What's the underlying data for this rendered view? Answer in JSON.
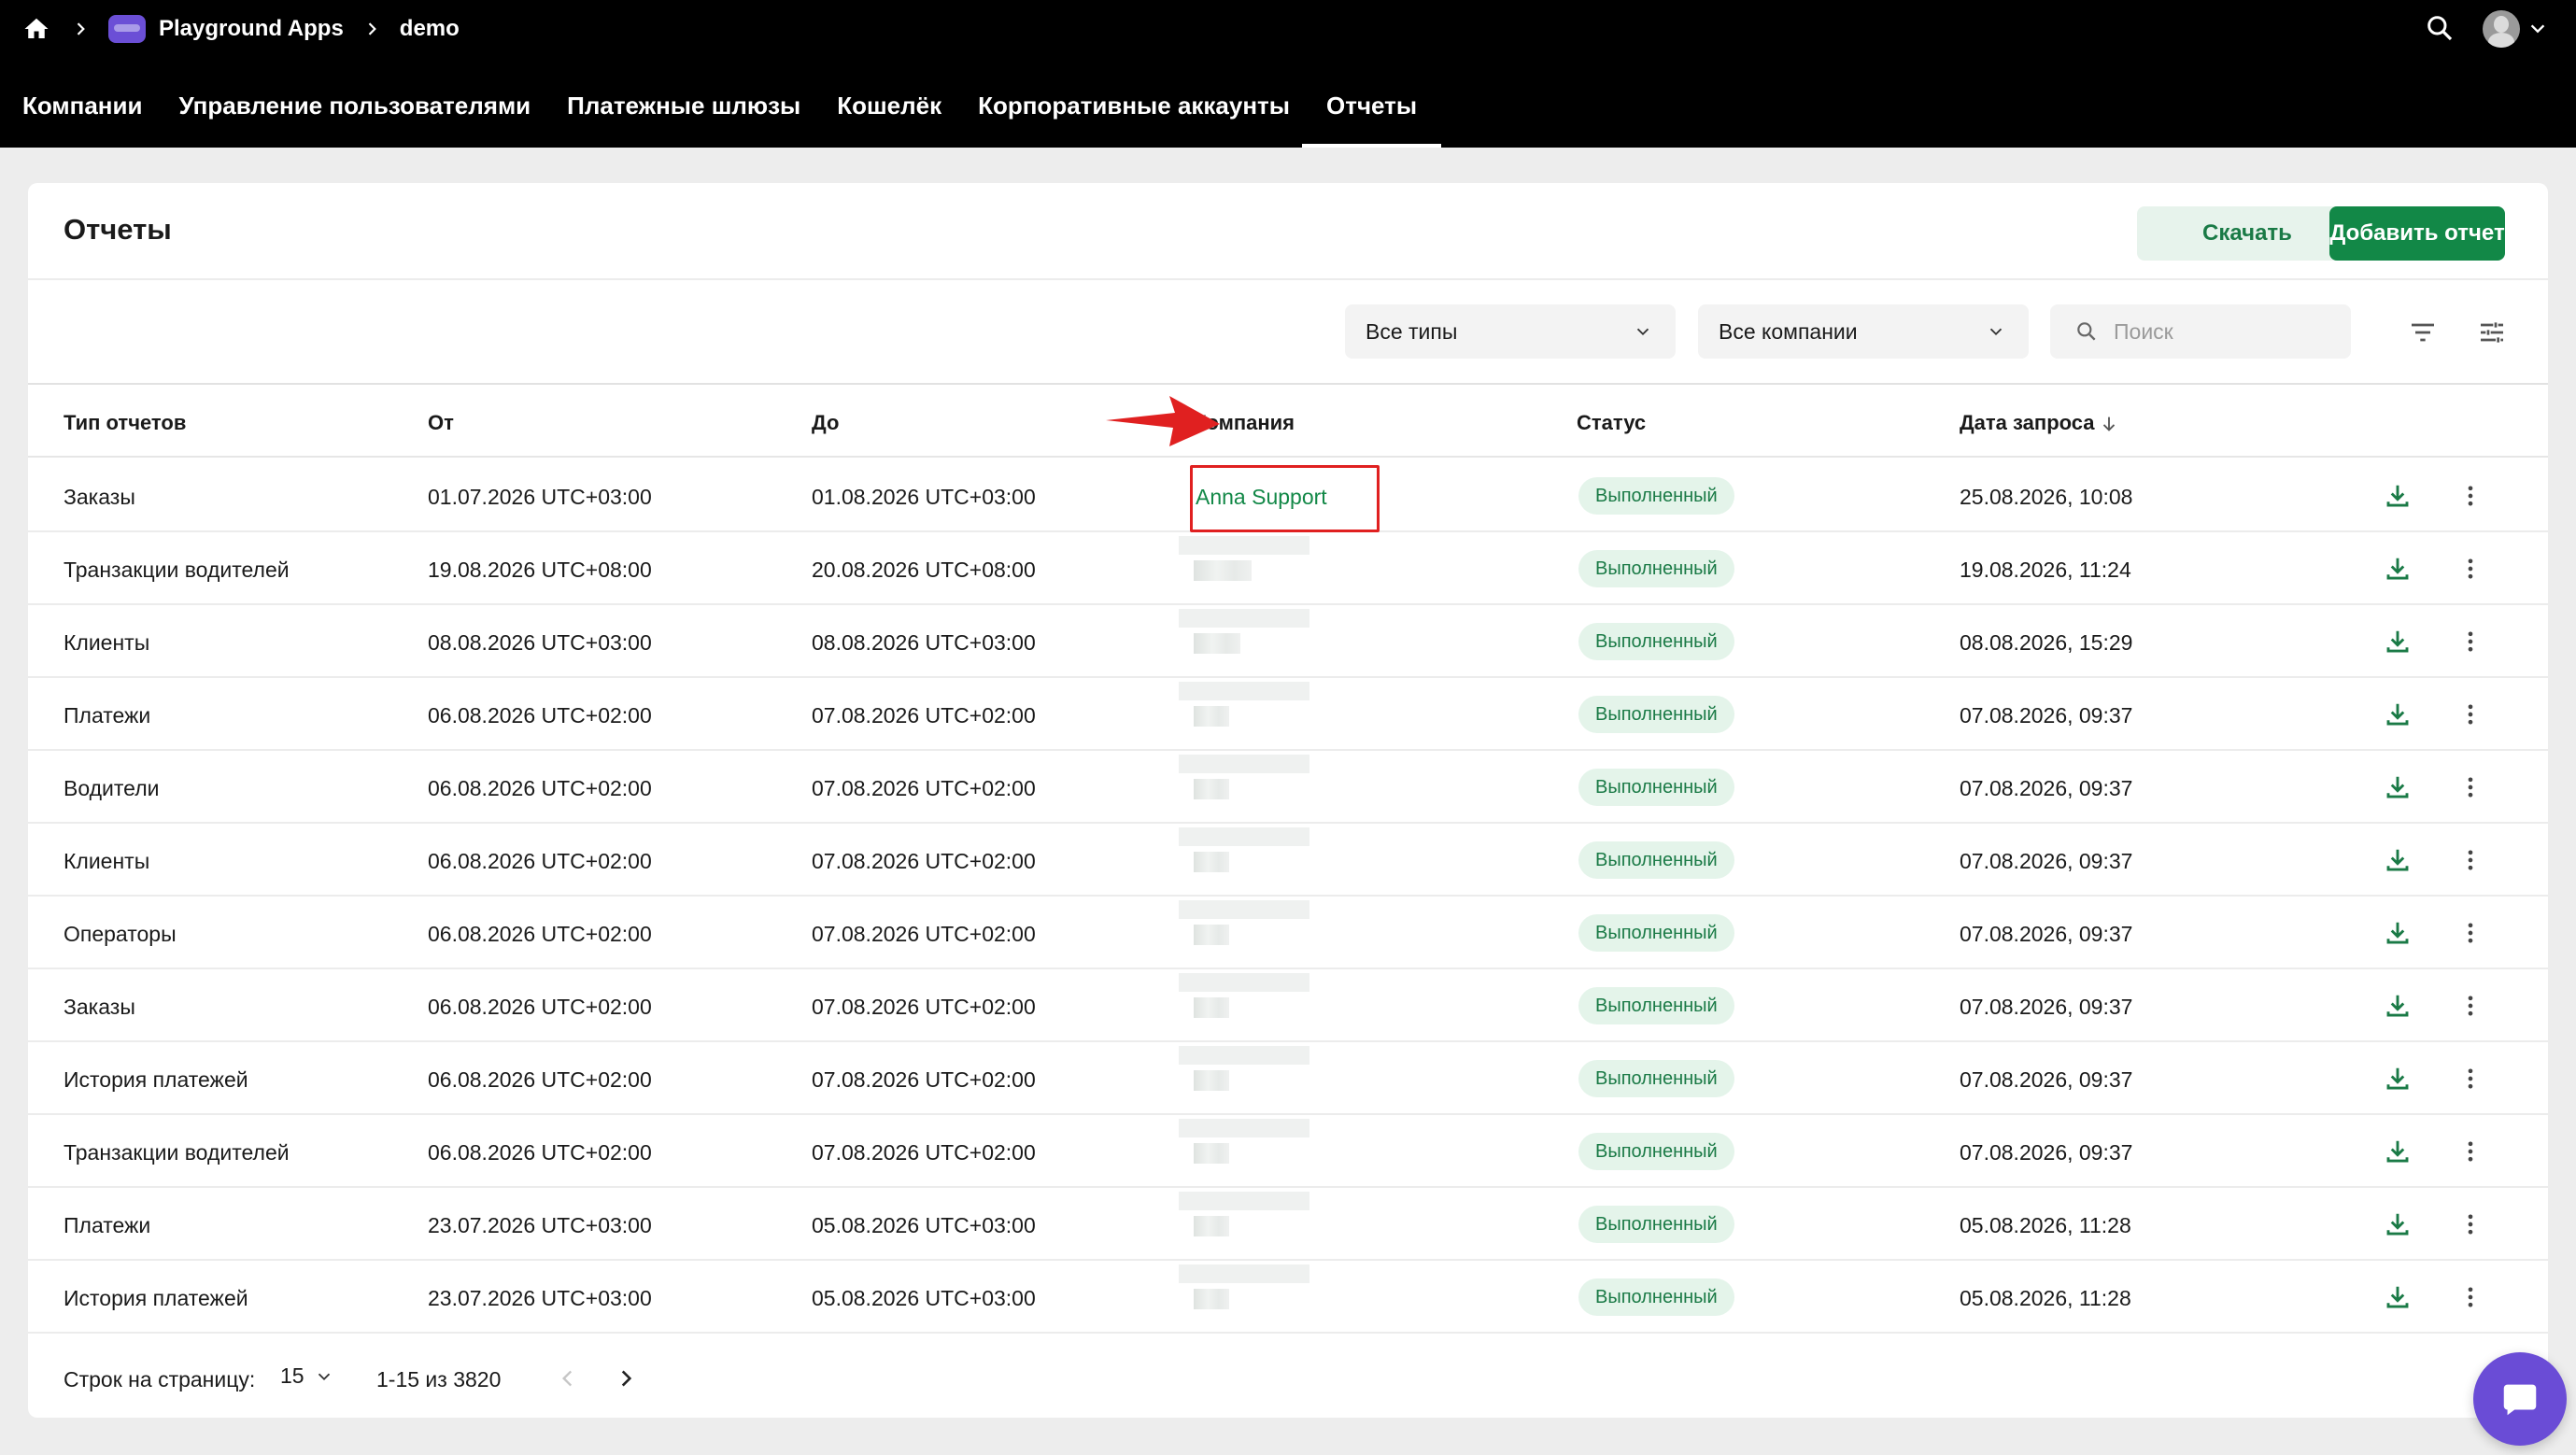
{
  "breadcrumb": {
    "home_icon": "home-icon",
    "app_name": "Playground Apps",
    "current": "demo"
  },
  "topbar": {
    "search_icon": "search-icon",
    "avatar_icon": "user-avatar",
    "chevron_icon": "chevron-down-icon"
  },
  "nav": {
    "tabs": [
      {
        "label": "Компании",
        "active": false
      },
      {
        "label": "Управление пользователями",
        "active": false
      },
      {
        "label": "Платежные шлюзы",
        "active": false
      },
      {
        "label": "Кошелёк",
        "active": false
      },
      {
        "label": "Корпоративные аккаунты",
        "active": false
      },
      {
        "label": "Отчеты",
        "active": true
      }
    ]
  },
  "page": {
    "title": "Отчеты",
    "download_label": "Скачать",
    "add_label": "Добавить отчет"
  },
  "filters": {
    "types_value": "Все типы",
    "companies_value": "Все компании",
    "search_placeholder": "Поиск"
  },
  "table": {
    "headers": {
      "type": "Тип отчетов",
      "from": "От",
      "to": "До",
      "company": "Компания",
      "status": "Статус",
      "date": "Дата запроса"
    },
    "rows": [
      {
        "type": "Заказы",
        "from": "01.07.2026 UTC+03:00",
        "to": "01.08.2026 UTC+03:00",
        "company": "Anna Support",
        "status": "Выполненный",
        "date": "25.08.2026, 10:08"
      },
      {
        "type": "Транзакции водителей",
        "from": "19.08.2026 UTC+08:00",
        "to": "20.08.2026 UTC+08:00",
        "company": "",
        "status": "Выполненный",
        "date": "19.08.2026, 11:24"
      },
      {
        "type": "Клиенты",
        "from": "08.08.2026 UTC+03:00",
        "to": "08.08.2026 UTC+03:00",
        "company": "",
        "status": "Выполненный",
        "date": "08.08.2026, 15:29"
      },
      {
        "type": "Платежи",
        "from": "06.08.2026 UTC+02:00",
        "to": "07.08.2026 UTC+02:00",
        "company": "",
        "status": "Выполненный",
        "date": "07.08.2026, 09:37"
      },
      {
        "type": "Водители",
        "from": "06.08.2026 UTC+02:00",
        "to": "07.08.2026 UTC+02:00",
        "company": "",
        "status": "Выполненный",
        "date": "07.08.2026, 09:37"
      },
      {
        "type": "Клиенты",
        "from": "06.08.2026 UTC+02:00",
        "to": "07.08.2026 UTC+02:00",
        "company": "",
        "status": "Выполненный",
        "date": "07.08.2026, 09:37"
      },
      {
        "type": "Операторы",
        "from": "06.08.2026 UTC+02:00",
        "to": "07.08.2026 UTC+02:00",
        "company": "",
        "status": "Выполненный",
        "date": "07.08.2026, 09:37"
      },
      {
        "type": "Заказы",
        "from": "06.08.2026 UTC+02:00",
        "to": "07.08.2026 UTC+02:00",
        "company": "",
        "status": "Выполненный",
        "date": "07.08.2026, 09:37"
      },
      {
        "type": "История платежей",
        "from": "06.08.2026 UTC+02:00",
        "to": "07.08.2026 UTC+02:00",
        "company": "",
        "status": "Выполненный",
        "date": "07.08.2026, 09:37"
      },
      {
        "type": "Транзакции водителей",
        "from": "06.08.2026 UTC+02:00",
        "to": "07.08.2026 UTC+02:00",
        "company": "",
        "status": "Выполненный",
        "date": "07.08.2026, 09:37"
      },
      {
        "type": "Платежи",
        "from": "23.07.2026 UTC+03:00",
        "to": "05.08.2026 UTC+03:00",
        "company": "",
        "status": "Выполненный",
        "date": "05.08.2026, 11:28"
      },
      {
        "type": "История платежей",
        "from": "23.07.2026 UTC+03:00",
        "to": "05.08.2026 UTC+03:00",
        "company": "",
        "status": "Выполненный",
        "date": "05.08.2026, 11:28"
      }
    ]
  },
  "pagination": {
    "rows_per_page_label": "Строк на страницу:",
    "rows_per_page_value": "15",
    "range": "1-15 из 3820"
  },
  "colors": {
    "accent_green": "#128847",
    "status_bg": "#e4f4ea",
    "header_bg": "#000000",
    "annotation_red": "#e02020",
    "chat_purple": "#6a4cd6"
  }
}
